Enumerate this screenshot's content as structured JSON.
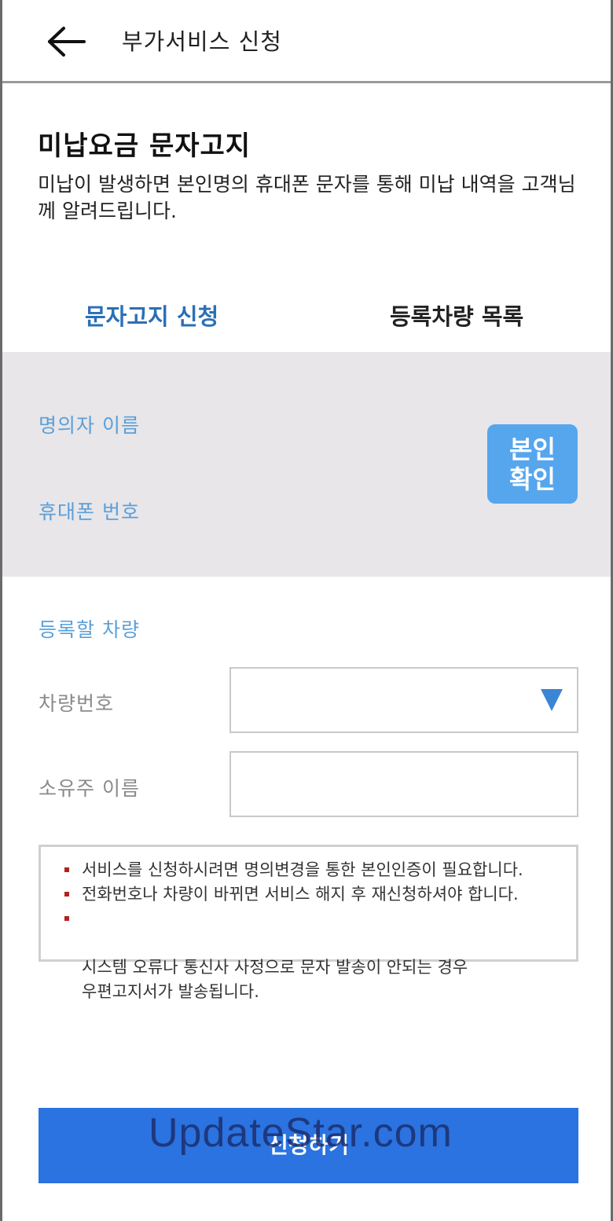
{
  "header": {
    "title": "부가서비스 신청"
  },
  "section": {
    "title": "미납요금 문자고지",
    "description": "미납이 발생하면 본인명의 휴대폰 문자를 통해 미납 내역을 고객님께 알려드립니다."
  },
  "tabs": [
    {
      "label": "문자고지 신청",
      "active": true
    },
    {
      "label": "등록차량 목록",
      "active": false
    }
  ],
  "owner_box": {
    "name_label": "명의자 이름",
    "phone_label": "휴대폰 번호",
    "verify_button": "본인\n확인"
  },
  "vehicle": {
    "section_label": "등록할 차량",
    "plate_label": "차량번호",
    "plate_value": "",
    "owner_label": "소유주 이름",
    "owner_value": ""
  },
  "notice": [
    "서비스를 신청하시려면 명의변경을 통한 본인인증이 필요합니다.",
    "전화번호나 차량이 바뀌면 서비스 해지 후 재신청하셔야 합니다.",
    "시스템 오류나 통신사 사정으로 문자 발송이 안되는 경우\n우편고지서가 발송됩니다."
  ],
  "submit_button": "신청하기",
  "watermark": "UpdateStar.com",
  "colors": {
    "accent_blue": "#2a73e0",
    "tab_active": "#2b6fb6",
    "label_blue": "#5b9fd8",
    "verify_button": "#56a6ee",
    "bullet_red": "#b4211f",
    "gray_box": "#e8e6e9"
  }
}
